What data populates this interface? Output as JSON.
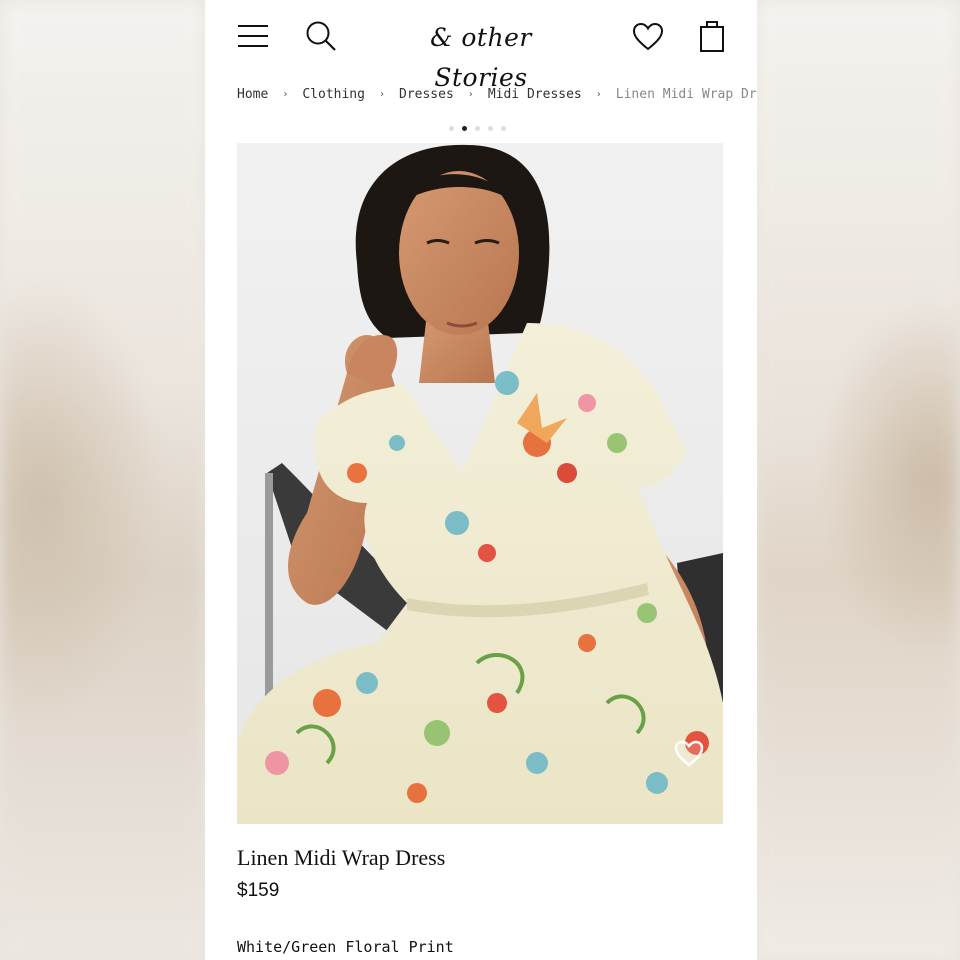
{
  "header": {
    "logo_text": "& other Stories",
    "icons": {
      "menu": "hamburger-menu-icon",
      "search": "search-icon",
      "wishlist": "heart-icon",
      "bag": "shopping-bag-icon"
    }
  },
  "breadcrumb": {
    "items": [
      "Home",
      "Clothing",
      "Dresses",
      "Midi Dresses",
      "Linen Midi Wrap Dress"
    ],
    "separator": "›"
  },
  "gallery": {
    "dot_count": 5,
    "active_dot": 2,
    "favorite_icon": "heart-outline-icon"
  },
  "product": {
    "name": "Linen Midi Wrap Dress",
    "price": "$159",
    "color": "White/Green Floral Print"
  },
  "colors": {
    "text": "#111111",
    "muted": "#888888",
    "background": "#ffffff"
  }
}
